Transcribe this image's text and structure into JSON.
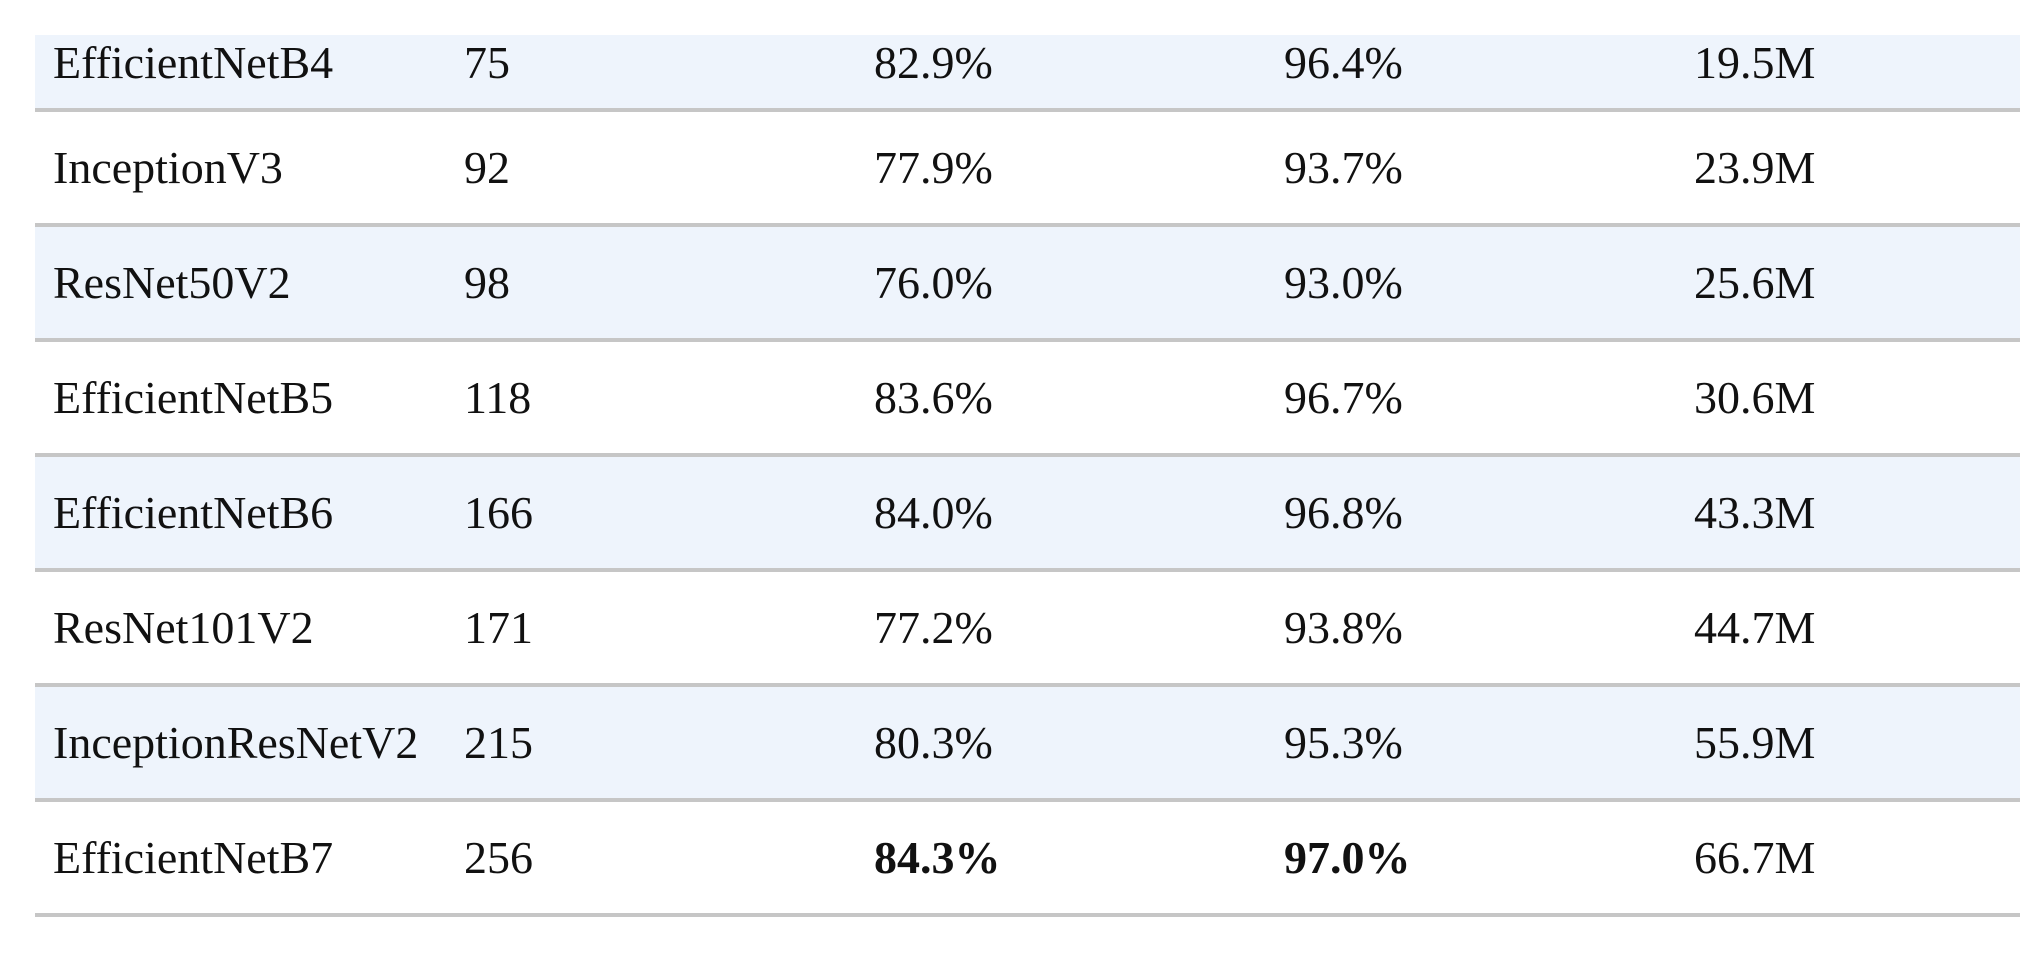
{
  "table": {
    "rows": [
      {
        "model": "EfficientNetB4",
        "size": "75",
        "top1": "82.9%",
        "top5": "96.4%",
        "params": "19.5M",
        "shaded": true,
        "bold_top1": false,
        "bold_top5": false
      },
      {
        "model": "InceptionV3",
        "size": "92",
        "top1": "77.9%",
        "top5": "93.7%",
        "params": "23.9M",
        "shaded": false,
        "bold_top1": false,
        "bold_top5": false
      },
      {
        "model": "ResNet50V2",
        "size": "98",
        "top1": "76.0%",
        "top5": "93.0%",
        "params": "25.6M",
        "shaded": true,
        "bold_top1": false,
        "bold_top5": false
      },
      {
        "model": "EfficientNetB5",
        "size": "118",
        "top1": "83.6%",
        "top5": "96.7%",
        "params": "30.6M",
        "shaded": false,
        "bold_top1": false,
        "bold_top5": false
      },
      {
        "model": "EfficientNetB6",
        "size": "166",
        "top1": "84.0%",
        "top5": "96.8%",
        "params": "43.3M",
        "shaded": true,
        "bold_top1": false,
        "bold_top5": false
      },
      {
        "model": "ResNet101V2",
        "size": "171",
        "top1": "77.2%",
        "top5": "93.8%",
        "params": "44.7M",
        "shaded": false,
        "bold_top1": false,
        "bold_top5": false
      },
      {
        "model": "InceptionResNetV2",
        "size": "215",
        "top1": "80.3%",
        "top5": "95.3%",
        "params": "55.9M",
        "shaded": true,
        "bold_top1": false,
        "bold_top5": false
      },
      {
        "model": "EfficientNetB7",
        "size": "256",
        "top1": "84.3%",
        "top5": "97.0%",
        "params": "66.7M",
        "shaded": false,
        "bold_top1": true,
        "bold_top5": true
      }
    ]
  },
  "colors": {
    "row_shade": "#eef4fc",
    "row_border": "#c6c6c6",
    "text": "#111111"
  }
}
